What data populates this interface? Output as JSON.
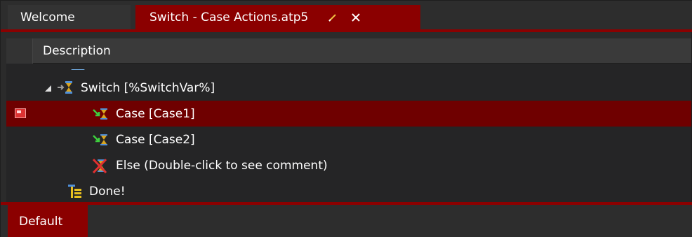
{
  "tabs": {
    "welcome_label": "Welcome",
    "active_label": "Switch - Case Actions.atp5",
    "modified_icon": "pencil-icon",
    "close_icon": "close-icon"
  },
  "grid": {
    "column_header": "Description",
    "rows": [
      {
        "label": "Switch [%SwitchVar%]",
        "icon": "switch-icon",
        "expanded": true,
        "selected": false
      },
      {
        "label": "Case [Case1]",
        "icon": "case-icon",
        "selected": true,
        "flagged": true
      },
      {
        "label": "Case [Case2]",
        "icon": "case-icon",
        "selected": false
      },
      {
        "label": "Else (Double-click to see comment)",
        "icon": "else-disabled-icon",
        "selected": false
      },
      {
        "label": "Done!",
        "icon": "done-icon",
        "selected": false
      }
    ]
  },
  "bottom": {
    "tab_label": "Default"
  },
  "colors": {
    "accent": "#8b0000",
    "selected_row": "#6f0000",
    "background": "#252526"
  }
}
